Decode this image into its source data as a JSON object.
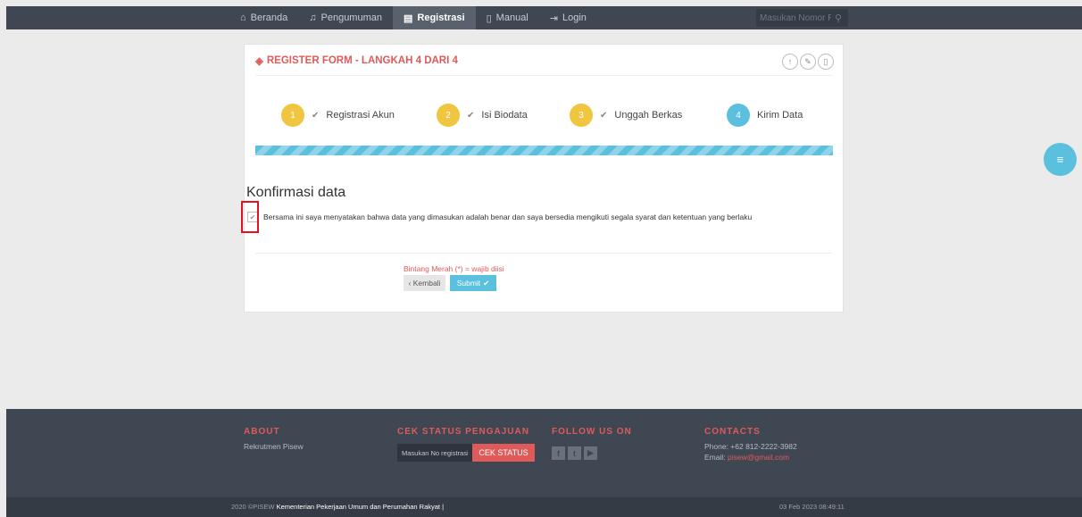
{
  "nav": {
    "items": [
      {
        "label": "Beranda",
        "icon": "home-icon",
        "glyph": "⌂"
      },
      {
        "label": "Pengumuman",
        "icon": "bell-icon",
        "glyph": "♫"
      },
      {
        "label": "Registrasi",
        "icon": "register-icon",
        "glyph": "▤",
        "active": true
      },
      {
        "label": "Manual",
        "icon": "document-icon",
        "glyph": "▯"
      },
      {
        "label": "Login",
        "icon": "login-icon",
        "glyph": "⇥"
      }
    ],
    "search_placeholder": "Masukan Nomor Regi"
  },
  "card": {
    "title": "REGISTER FORM - LANGKAH 4 DARI 4",
    "steps": [
      {
        "num": "1",
        "label": "Registrasi Akun",
        "done": true
      },
      {
        "num": "2",
        "label": "Isi Biodata",
        "done": true
      },
      {
        "num": "3",
        "label": "Unggah Berkas",
        "done": true
      },
      {
        "num": "4",
        "label": "Kirim Data",
        "done": false
      }
    ],
    "progress_percent": 100,
    "section_title": "Konfirmasi data",
    "confirm_text": "Bersama ini saya menyatakan bahwa data yang dimasukan adalah benar dan saya bersedia mengikuti segala syarat dan ketentuan yang berlaku",
    "confirm_checked": true,
    "required_note": "Bintang Merah (*) = wajib diisi",
    "back_label": "‹ Kembali",
    "submit_label": "Submit"
  },
  "footer": {
    "about_head": "ABOUT",
    "about_text": "Rekrutmen Pisew",
    "status_head": "CEK STATUS PENGAJUAN",
    "status_placeholder": "Masukan No registrasi",
    "status_button": "CEK STATUS",
    "follow_head": "FOLLOW US ON",
    "contacts_head": "CONTACTS",
    "phone": "Phone: +62 812-2222-3982",
    "email_label": "Email: ",
    "email": "pisew@gmail.com",
    "copyright_prefix": "2020 ©PISEW ",
    "copyright_org": "Kementerian Pekerjaan Umum dan Perumahan Rakyat |",
    "datetime": "03 Feb 2023 08:49:11"
  },
  "colors": {
    "accent": "#5bc0de",
    "brand_red": "#e05a5a",
    "step_done": "#f0c53f",
    "dark": "#3f4753"
  }
}
